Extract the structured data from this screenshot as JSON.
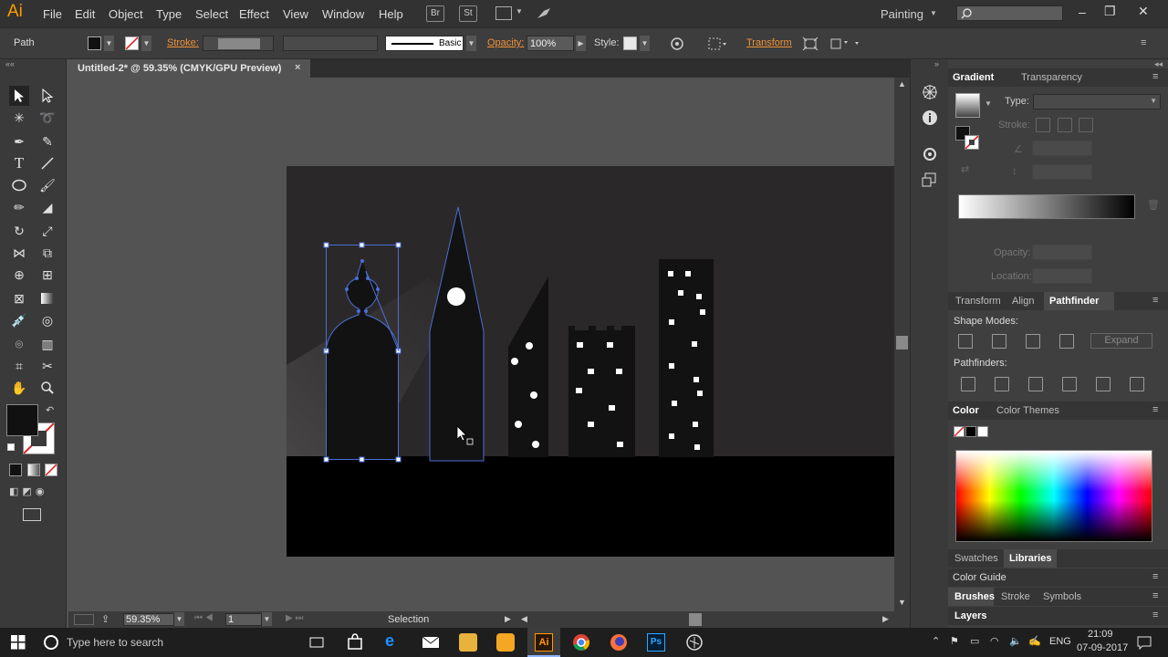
{
  "app": {
    "logo": "Ai",
    "workspace": "Painting"
  },
  "menu": [
    "File",
    "Edit",
    "Object",
    "Type",
    "Select",
    "Effect",
    "View",
    "Window",
    "Help"
  ],
  "menu_buttons": {
    "bridge": "Br",
    "stock": "St"
  },
  "control_bar": {
    "selection_type": "Path",
    "stroke_label": "Stroke:",
    "brush_label": "Basic",
    "opacity_label": "Opacity:",
    "opacity_value": "100%",
    "style_label": "Style:",
    "transform_label": "Transform"
  },
  "document_tab": {
    "title": "Untitled-2* @ 59.35% (CMYK/GPU Preview)",
    "close": "×"
  },
  "status_bar": {
    "zoom": "59.35%",
    "page": "1",
    "tool": "Selection"
  },
  "panels": {
    "gradient": {
      "tabs": [
        "Gradient",
        "Transparency"
      ],
      "type_label": "Type:",
      "stroke_label": "Stroke:",
      "opacity_label": "Opacity:",
      "location_label": "Location:"
    },
    "pathfinder": {
      "tabs": [
        "Transform",
        "Align",
        "Pathfinder"
      ],
      "shape_modes": "Shape Modes:",
      "expand": "Expand",
      "pathfinders": "Pathfinders:"
    },
    "color": {
      "tabs": [
        "Color",
        "Color Themes"
      ]
    },
    "swatches": {
      "tabs": [
        "Swatches",
        "Libraries"
      ]
    },
    "color_guide": "Color Guide",
    "brushes": {
      "tabs": [
        "Brushes",
        "Stroke",
        "Symbols"
      ]
    },
    "layers": "Layers"
  },
  "taskbar": {
    "search_placeholder": "Type here to search",
    "lang": "ENG",
    "time": "21:09",
    "date": "07-09-2017"
  },
  "colors": {
    "accent": "#f09237",
    "canvas_sky": "#2b2829",
    "ground": "#000000",
    "selection": "#4a6fd6"
  },
  "window_controls": {
    "minimize": "–",
    "maximize": "❐",
    "close": "✕"
  }
}
